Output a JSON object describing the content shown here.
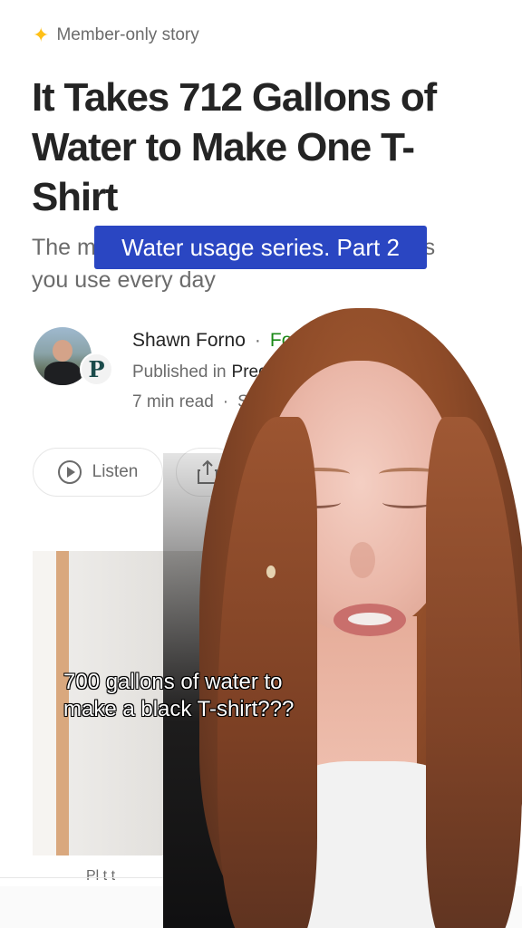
{
  "article": {
    "member_badge": "Member-only story",
    "title": "It Takes 712 Gallons of Water to Make One T-Shirt",
    "subtitle_start": "The m",
    "subtitle_end": "ngs",
    "subtitle_line2": "you use every day"
  },
  "banner": {
    "text": "Water usage series. Part 2"
  },
  "author": {
    "name": "Shawn Forno",
    "separator": "·",
    "follow_label": "Fo",
    "published_prefix": "Published in",
    "publication": "Pred",
    "publication_icon_letter": "P",
    "read_time": "7 min read",
    "meta_separator": "·",
    "meta_trail": "S"
  },
  "actions": {
    "listen_label": "Listen"
  },
  "image": {
    "caption_partial": "Pl t t"
  },
  "video_caption": {
    "line1": "700 gallons of water to",
    "line2": "make a black T-shirt???"
  },
  "colors": {
    "banner": "#2a46c2",
    "follow": "#1a8917",
    "star": "#ffc017"
  }
}
